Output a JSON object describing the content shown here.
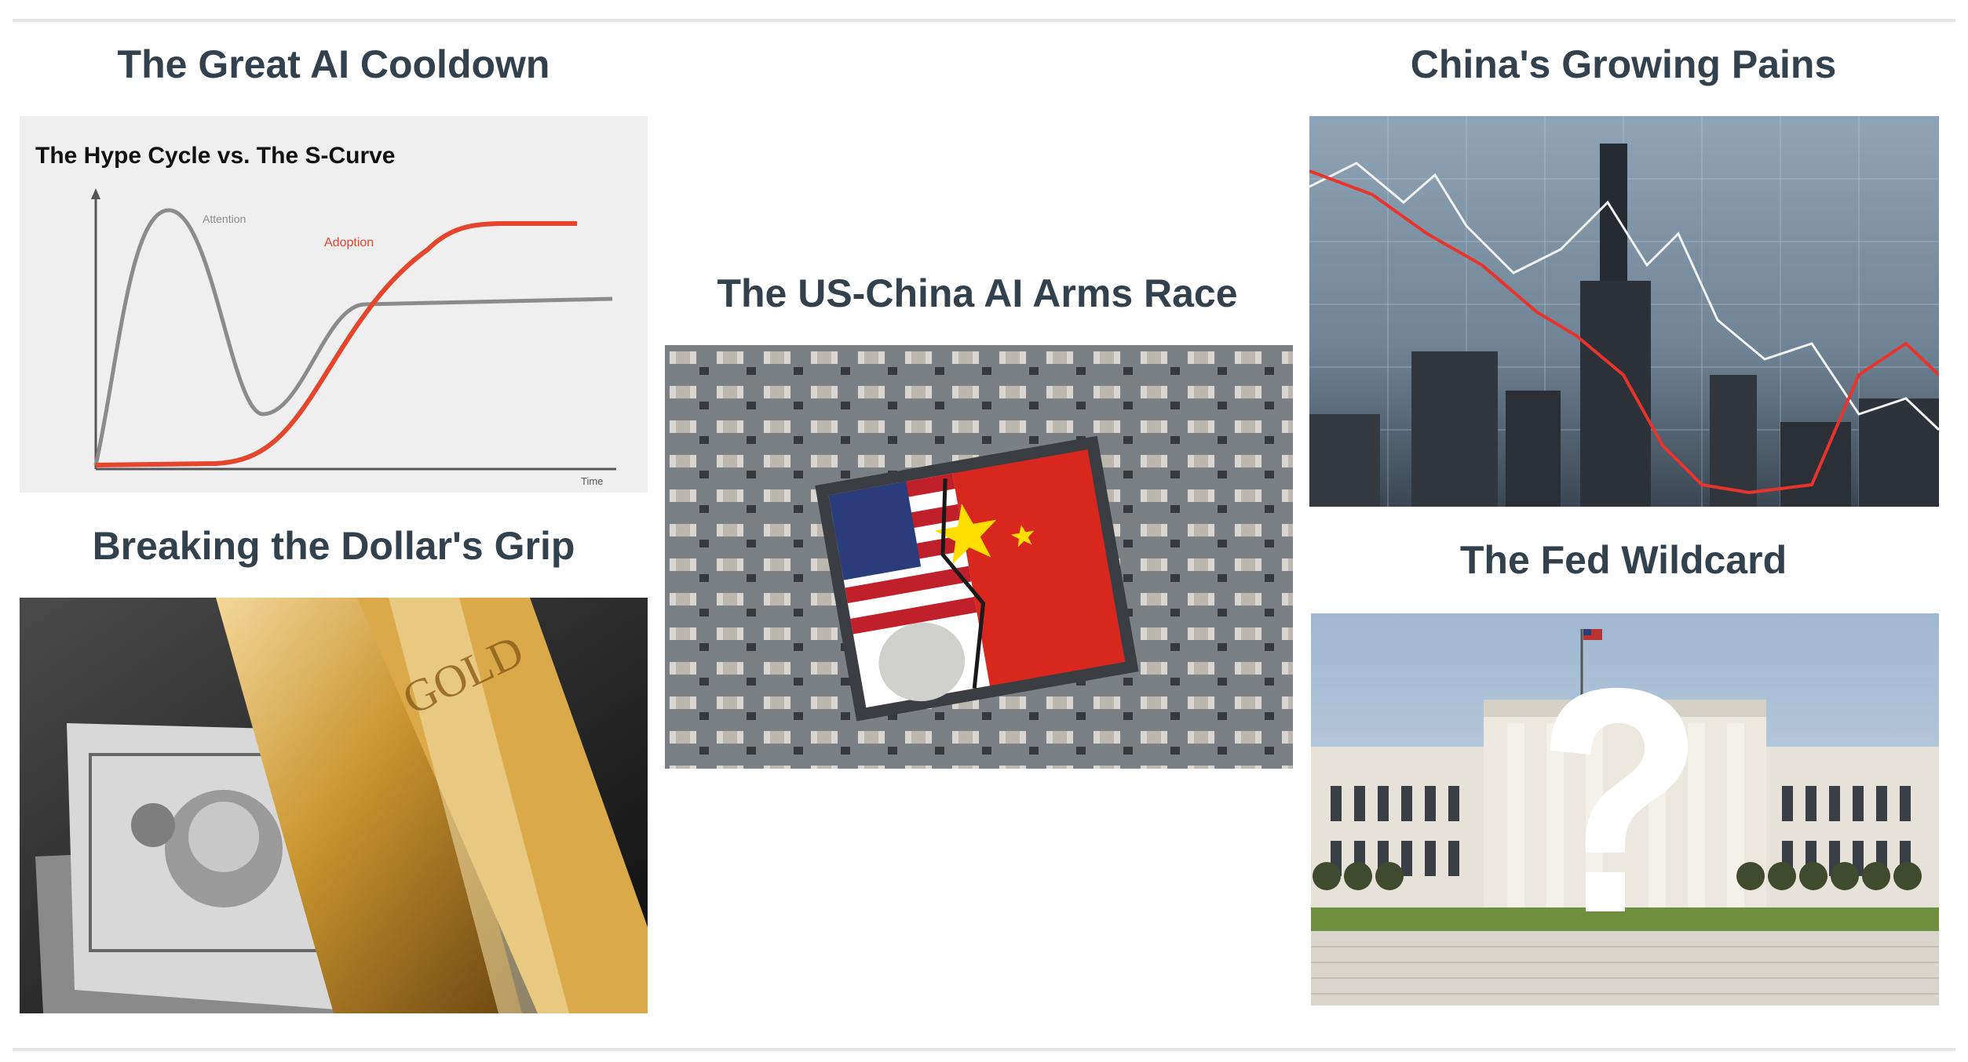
{
  "articles": [
    {
      "title": "The Great AI Cooldown",
      "image": {
        "heading": "The Hype Cycle  vs.  The S-Curve",
        "labels": [
          "Attention",
          "Adoption",
          "Time"
        ]
      }
    },
    {
      "title": "Breaking the Dollar's Grip"
    },
    {
      "title": "The US-China AI Arms Race"
    },
    {
      "title": "China's Growing Pains"
    },
    {
      "title": "The Fed Wildcard"
    }
  ]
}
